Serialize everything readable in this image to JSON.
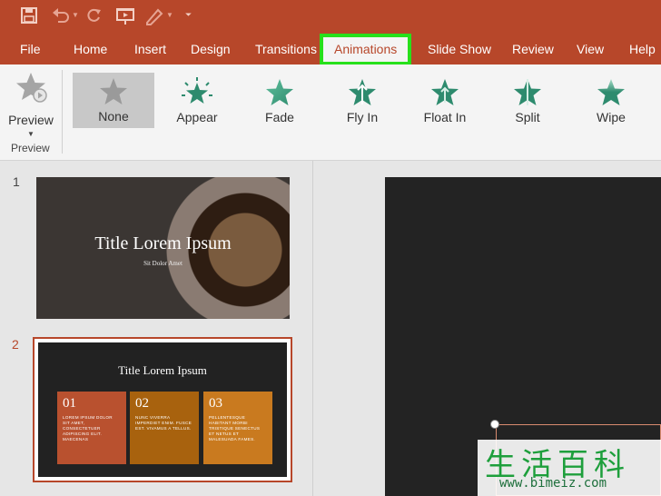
{
  "quick_access": {
    "save_icon": "save-icon",
    "undo_icon": "undo-icon",
    "redo_icon": "redo-icon",
    "present_icon": "present-from-start-icon",
    "draw_icon": "touch-draw-icon",
    "customize_icon": "customize-toolbar-icon"
  },
  "tabs": [
    {
      "label": "File"
    },
    {
      "label": "Home"
    },
    {
      "label": "Insert"
    },
    {
      "label": "Design"
    },
    {
      "label": "Transitions"
    },
    {
      "label": "Animations",
      "active": true
    },
    {
      "label": "Slide Show"
    },
    {
      "label": "Review"
    },
    {
      "label": "View"
    },
    {
      "label": "Help"
    }
  ],
  "ribbon": {
    "preview_label": "Preview",
    "preview_group_label": "Preview",
    "animations": [
      {
        "label": "None",
        "selected": true
      },
      {
        "label": "Appear"
      },
      {
        "label": "Fade"
      },
      {
        "label": "Fly In"
      },
      {
        "label": "Float In"
      },
      {
        "label": "Split"
      },
      {
        "label": "Wipe"
      }
    ]
  },
  "slides": [
    {
      "number": "1",
      "title": "Title Lorem Ipsum",
      "subtitle": "Sit Dolor Amet"
    },
    {
      "number": "2",
      "title": "Title Lorem Ipsum",
      "boxes": [
        {
          "num": "01",
          "text": "LOREM IPSUM DOLOR SIT AMET, CONSECTETUER ADIPISCING ELIT. MAECENAS"
        },
        {
          "num": "02",
          "text": "NUNC VIVERRA IMPERDIET ENIM. FUSCE EST. VIVAMUS A TELLUS."
        },
        {
          "num": "03",
          "text": "PELLENTESQUE HABITANT MORBI TRISTIQUE SENECTUS ET NETUS ET MALESUADA FAMES."
        }
      ]
    }
  ],
  "watermark": {
    "text": "生活百科",
    "url": "www.bimeiz.com"
  },
  "colors": {
    "brand": "#b7472a",
    "highlight": "#27e01b",
    "anim_star": "#2e8b6e",
    "box1": "#b9512f",
    "box2": "#a8620e",
    "box3": "#c97a1f"
  }
}
